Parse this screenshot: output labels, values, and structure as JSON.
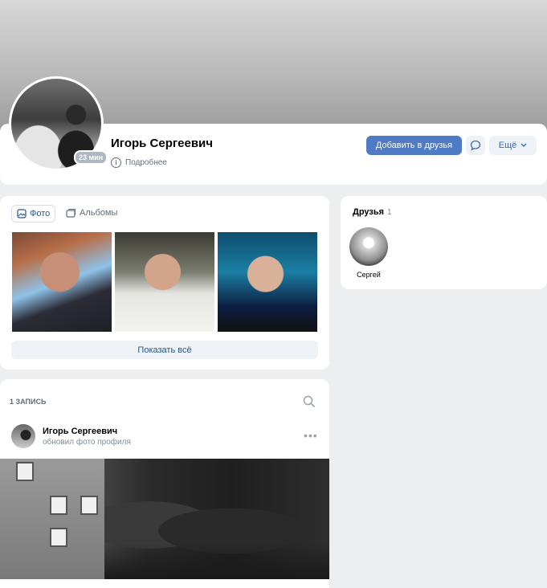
{
  "profile": {
    "name": "Игорь Сергеевич",
    "details_label": "Подробнее",
    "avatar_badge": "23 мин",
    "add_friend_label": "Добавить в друзья",
    "more_label": "Ещё"
  },
  "photos": {
    "tabs": [
      {
        "label": "Фото",
        "icon": "photo-icon",
        "active": true
      },
      {
        "label": "Альбомы",
        "icon": "album-icon",
        "active": false
      }
    ],
    "show_all_label": "Показать всё"
  },
  "friends": {
    "title": "Друзья",
    "count": "1",
    "items": [
      {
        "name": "Сергей"
      }
    ]
  },
  "wall": {
    "count_label": "1 ЗАПИСЬ",
    "post": {
      "author": "Игорь Сергеевич",
      "subtitle": "обновил фото профиля"
    }
  },
  "colors": {
    "accent": "#4e7bc3",
    "link": "#2a5885",
    "page_bg": "#edeef0"
  }
}
